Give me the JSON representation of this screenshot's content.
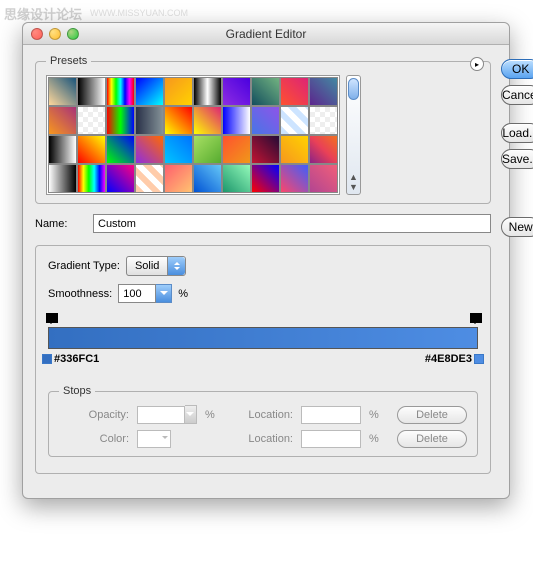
{
  "watermark": "思缘设计论坛",
  "watermark_url": "WWW.MISSYUAN.COM",
  "title": "Gradient Editor",
  "buttons": {
    "ok": "OK",
    "cancel": "Cancel",
    "load": "Load...",
    "save": "Save...",
    "new": "New"
  },
  "presets": {
    "legend": "Presets",
    "swatches": [
      "linear-gradient(45deg,#ffd89b,#19547b)",
      "linear-gradient(90deg,#000,#fff)",
      "linear-gradient(90deg,#ff0000,#ffff00,#00ff00,#00ffff,#0000ff,#ff00ff,#ff0000)",
      "linear-gradient(135deg,#00f,#0ff)",
      "linear-gradient(135deg,#f7971e,#ffd200)",
      "linear-gradient(90deg,#000,#fff,#000)",
      "linear-gradient(45deg,#8e2de2,#4a00e0)",
      "linear-gradient(45deg,#134e5e,#71b280)",
      "linear-gradient(45deg,#ff512f,#dd2476)",
      "linear-gradient(45deg,#5c258d,#4389a2)",
      "linear-gradient(45deg,#f7971e,#a83279)",
      "repeating-conic-gradient(#eee 0 25%,#fff 0 50%) 0 0/10px 10px",
      "linear-gradient(90deg,#ff0000,#00ff00,#0000ff)",
      "linear-gradient(90deg,#283048,#859398)",
      "linear-gradient(45deg,#ff0,#f00)",
      "linear-gradient(45deg,#ff0,#dd2476)",
      "linear-gradient(90deg,#00f,#fff)",
      "linear-gradient(45deg,#4776e6,#8e54e9)",
      "repeating-linear-gradient(45deg,#cde4ff 0 6px,#fff 6px 12px)",
      "repeating-conic-gradient(#eee 0 25%,#fff 0 50%) 0 0/10px 10px",
      "linear-gradient(90deg,#000,#fff)",
      "linear-gradient(45deg,#f00,#ff0)",
      "linear-gradient(45deg,#0f0,#00f)",
      "linear-gradient(45deg,#8e2de2,#ff6a00)",
      "linear-gradient(45deg,#00c6ff,#0072ff)",
      "linear-gradient(135deg,#a8e063,#56ab2f)",
      "linear-gradient(135deg,#ff512f,#f09819)",
      "linear-gradient(45deg,#c31432,#240b36)",
      "linear-gradient(45deg,#f7971e,#ffd200)",
      "linear-gradient(45deg,#8a2387,#e94057,#f27121)",
      "linear-gradient(90deg,#fff,#000)",
      "linear-gradient(90deg,#ff0000,#ffff00,#00ff00,#00ffff,#0000ff,#ff00ff)",
      "linear-gradient(45deg,#00f,#ff0080)",
      "repeating-linear-gradient(45deg,#fca 0 6px,#fff 6px 12px)",
      "linear-gradient(135deg,#ff5f6d,#ffc371)",
      "linear-gradient(45deg,#0052d4,#65c7f7)",
      "linear-gradient(45deg,#1d976c,#93f9b9)",
      "linear-gradient(45deg,#f00,#00f)",
      "linear-gradient(45deg,#fc466b,#3f5efb)",
      "linear-gradient(45deg,#b24592,#f15f79)"
    ]
  },
  "name": {
    "label": "Name:",
    "value": "Custom"
  },
  "gradientType": {
    "label": "Gradient Type:",
    "value": "Solid"
  },
  "smoothness": {
    "label": "Smoothness:",
    "value": "100",
    "unit": "%"
  },
  "gradient": {
    "left": "#336FC1",
    "right": "#4E8DE3"
  },
  "stops": {
    "legend": "Stops",
    "opacity": "Opacity:",
    "color": "Color:",
    "location": "Location:",
    "pct": "%",
    "delete": "Delete"
  }
}
